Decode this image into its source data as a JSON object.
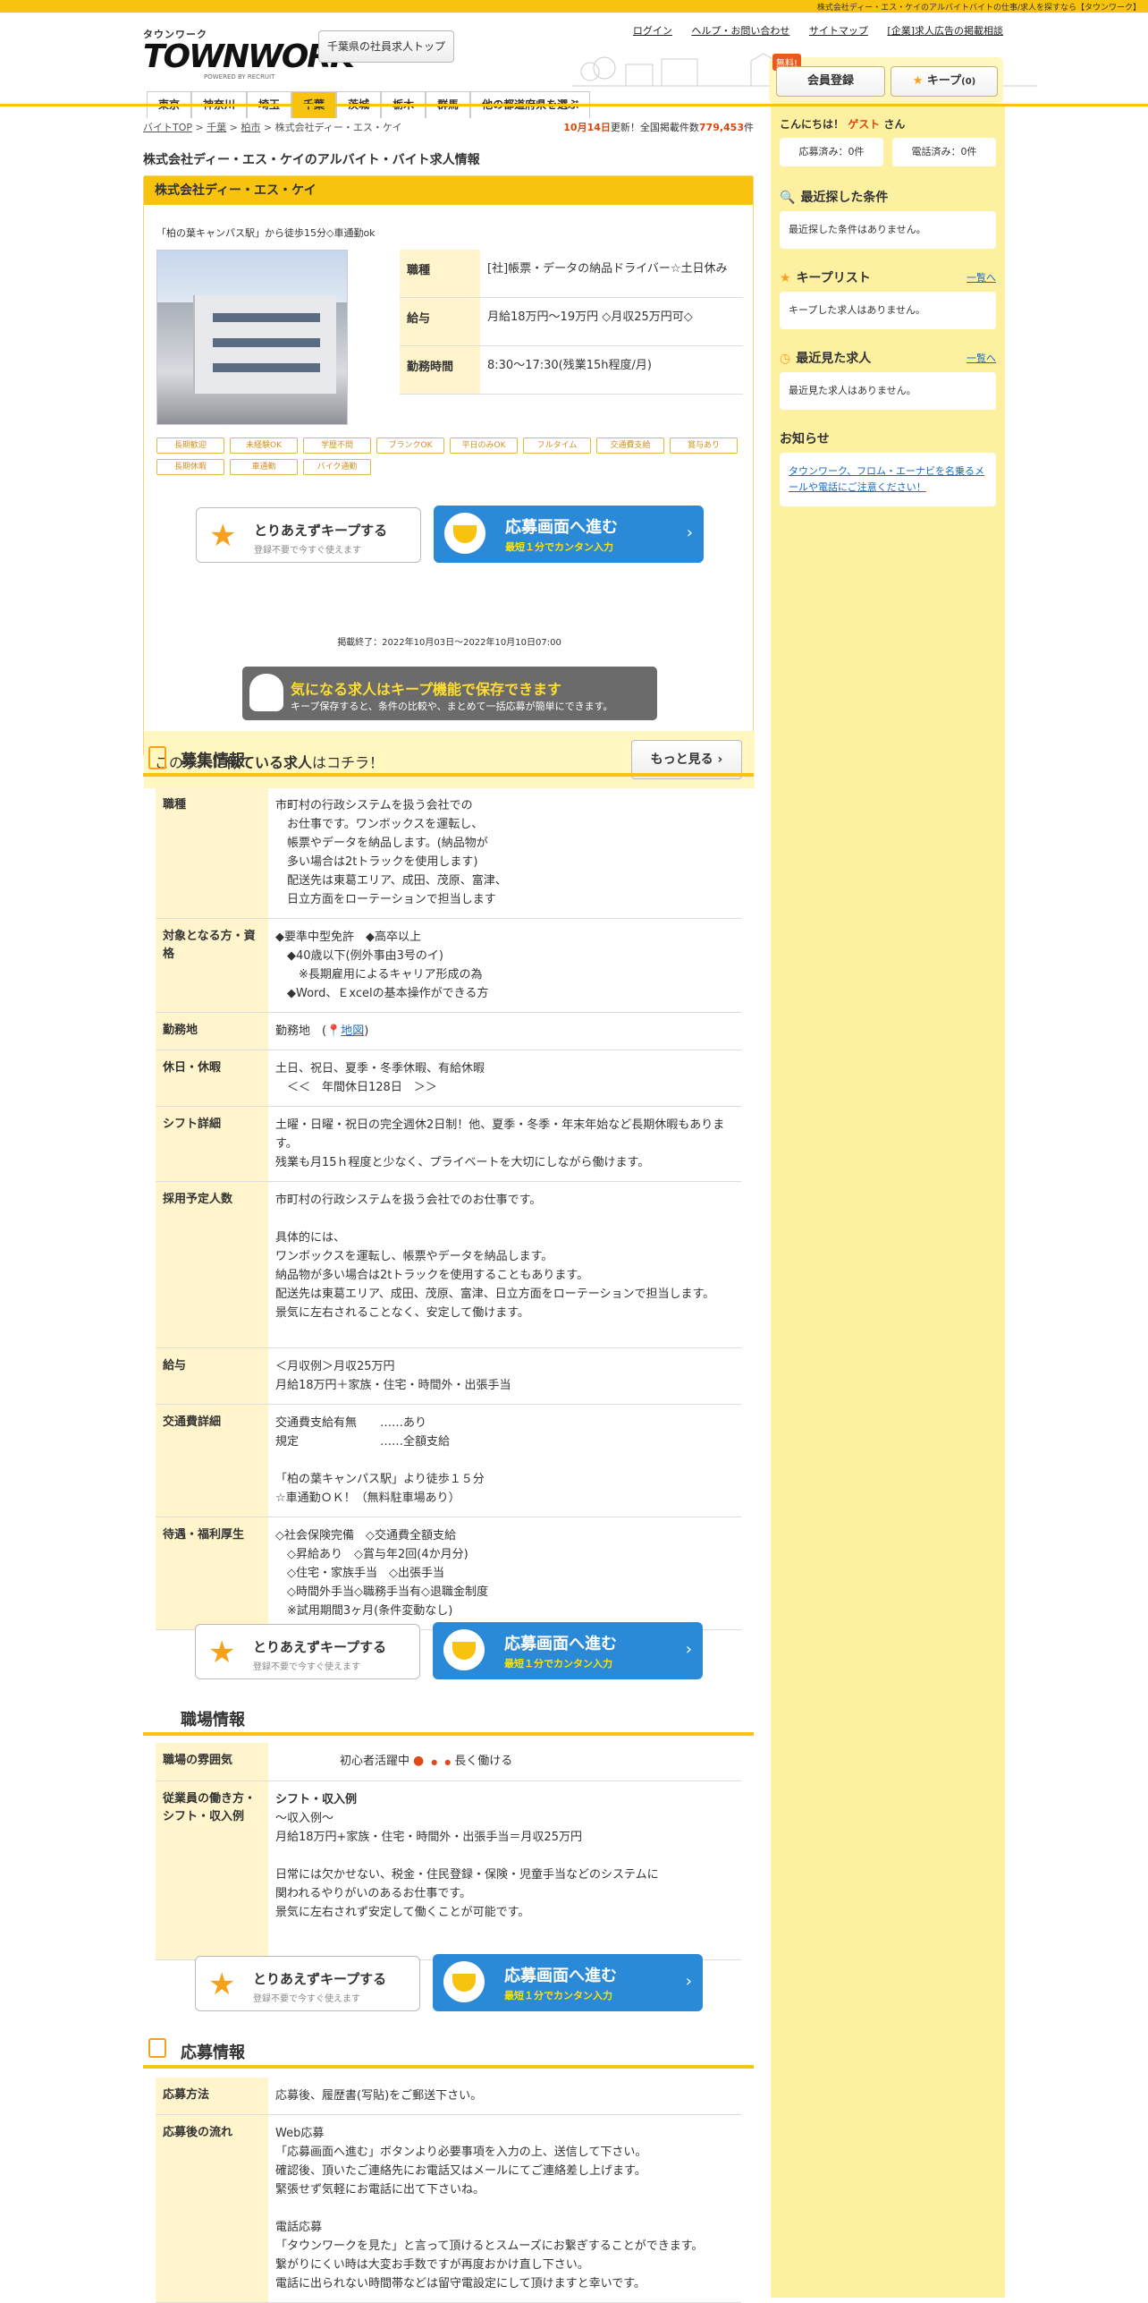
{
  "top_strip": "株式会社ディー・エス・ケイのアルバイトバイトの仕事/求人を探すなら【タウンワーク】",
  "logo": {
    "kana": "タウンワーク",
    "word": "TOWNWORK",
    "powered": "POWERED BY RECRUIT"
  },
  "header": {
    "pref_top": "千葉県の社員求人トップ",
    "links": [
      "ログイン",
      "ヘルプ・お問い合わせ",
      "サイトマップ",
      "[企業]求人広告の掲載相談"
    ],
    "free": "無料!",
    "member": "会員登録",
    "keep": "キープ",
    "keep_count": "(0)"
  },
  "pref_tabs": [
    "東京",
    "神奈川",
    "埼玉",
    "千葉",
    "茨城",
    "栃木",
    "群馬",
    "他の都道府県を選ぶ"
  ],
  "crumb": [
    "バイトTOP",
    "千葉",
    "柏市",
    "株式会社ディー・エス・ケイ"
  ],
  "updated": {
    "date": "10月14日",
    "text1": "更新！全国掲載件数",
    "count": "779,453",
    "unit": "件"
  },
  "page_title": "株式会社ディー・エス・ケイのアルバイト・バイト求人情報",
  "company": {
    "name": "株式会社ディー・エス・ケイ",
    "catch": "「柏の葉キャンパス駅」から徒歩15分◇車通勤ok",
    "summary": [
      {
        "k": "職種",
        "v": "[社]帳票・データの納品ドライバー☆土日休み"
      },
      {
        "k": "給与",
        "v": "月給18万円～19万円 ◇月収25万円可◇"
      },
      {
        "k": "勤務時間",
        "v": "8:30～17:30(残業15h程度/月)"
      }
    ],
    "tags": [
      "長期歓迎",
      "未経験OK",
      "学歴不問",
      "ブランクOK",
      "平日のみOK",
      "フルタイム",
      "交通費支給",
      "賞与あり",
      "長期休暇",
      "車通勤",
      "バイク通勤"
    ],
    "period": "掲載終了：2022年10月03日～2022年10月10日07:00"
  },
  "keep_cta": {
    "title": "とりあえずキープする",
    "sub": "登録不要で今すぐ使えます"
  },
  "apply_cta": {
    "title": "応募画面へ進む",
    "sub": "最短１分でカンタン入力"
  },
  "keep_banner": {
    "title": "気になる求人はキープ機能で保存できます",
    "sub": "キープ保存すると、条件の比較や、まとめて一括応募が簡単にできます。"
  },
  "similar": {
    "pre": "この求人に",
    "bold": "似ている求人",
    "post": "はコチラ！",
    "more": "もっと見る"
  },
  "boshu": {
    "title": "募集情報",
    "rows": [
      {
        "k": "職種",
        "v": "市町村の行政システムを扱う会社での\n　お仕事です。ワンボックスを運転し、\n　帳票やデータを納品します。(納品物が\n　多い場合は2tトラックを使用します)\n　配送先は東葛エリア、成田、茂原、富津、\n　日立方面をローテーションで担当します"
      },
      {
        "k": "対象となる方・資格",
        "v": "◆要準中型免許　◆高卒以上\n　◆40歳以下(例外事由3号のイ)\n　　※長期雇用によるキャリア形成の為\n　◆Word、Ｅxcelの基本操作ができる方"
      },
      {
        "k": "勤務地",
        "v": "勤務地"
      },
      {
        "k": "休日・休暇",
        "v": "土日、祝日、夏季・冬季休暇、有給休暇\n　＜＜　年間休日128日　＞＞"
      },
      {
        "k": "シフト詳細",
        "v": "土曜・日曜・祝日の完全週休2日制！他、夏季・冬季・年末年始など長期休暇もあります。\n残業も月15ｈ程度と少なく、プライベートを大切にしながら働けます。"
      },
      {
        "k": "採用予定人数",
        "v": "市町村の行政システムを扱う会社でのお仕事です。\n\n具体的には、\nワンボックスを運転し、帳票やデータを納品します。\n納品物が多い場合は2tトラックを使用することもあります。\n配送先は東葛エリア、成田、茂原、富津、日立方面をローテーションで担当します。\n景気に左右されることなく、安定して働けます。"
      },
      {
        "k": "給与",
        "v": "＜月収例＞月収25万円\n月給18万円＋家族・住宅・時間外・出張手当"
      },
      {
        "k": "交通費詳細",
        "v": "交通費支給有無　　……あり\n規定　　　　　　　……全額支給\n\n「柏の葉キャンパス駅」より徒歩１５分\n☆車通勤ＯＫ！（無料駐車場あり）"
      },
      {
        "k": "待遇・福利厚生",
        "v": "◇社会保険完備　◇交通費全額支給\n　◇昇給あり　◇賞与年2回(4か月分)\n　◇住宅・家族手当　◇出張手当\n　◇時間外手当◇職務手当有◇退職金制度\n　※試用期間3ヶ月(条件変動なし)"
      }
    ],
    "map": "地図"
  },
  "shokuba": {
    "title": "職場情報",
    "atmos_k": "職場の雰囲気",
    "atmos_left": "初心者活躍中",
    "atmos_right": "長く働ける",
    "work_k": "従業員の働き方・シフト・収入例",
    "work_title": "シフト・収入例",
    "work_v": "～収入例～\n月給18万円+家族・住宅・時間外・出張手当＝月収25万円\n\n日常には欠かせない、税金・住民登録・保険・児童手当などのシステムに\n関われるやりがいのあるお仕事です。\n景気に左右されず安定して働くことが可能です。"
  },
  "oubo": {
    "title": "応募情報",
    "rows": [
      {
        "k": "応募方法",
        "v": "応募後、履歴書(写貼)をご郵送下さい。"
      },
      {
        "k": "応募後の流れ",
        "v": "Web応募\n「応募画面へ進む」ボタンより必要事項を入力の上、送信して下さい。\n確認後、頂いたご連絡先にお電話又はメールにてご連絡差し上げます。\n緊張せず気軽にお電話に出て下さいね。\n\n電話応募\n「タウンワークを見た」と言って頂けるとスムーズにお繋ぎすることができます。\n繋がりにくい時は大変お手数ですが再度おかけ直し下さい。\n電話に出られない時間帯などは留守電設定にして頂けますと幸いです。"
      }
    ]
  },
  "sidebar": {
    "hello": "こんにちは！",
    "guest": "ゲスト",
    "san": "さん",
    "applied": "応募済み：0件",
    "called": "電話済み：0件",
    "recent_search_h": "最近探した条件",
    "recent_search_v": "最近探した条件はありません。",
    "keep_list_h": "キープリスト",
    "keep_list_link": "一覧へ",
    "keep_list_v": "キープした求人はありません。",
    "recent_view_h": "最近見た求人",
    "recent_view_link": "一覧へ",
    "recent_view_v": "最近見た求人はありません。",
    "notice_h": "お知らせ",
    "notice_v": "タウンワーク、フロム・エーナビを名乗るメールや電話にご注意ください！"
  }
}
